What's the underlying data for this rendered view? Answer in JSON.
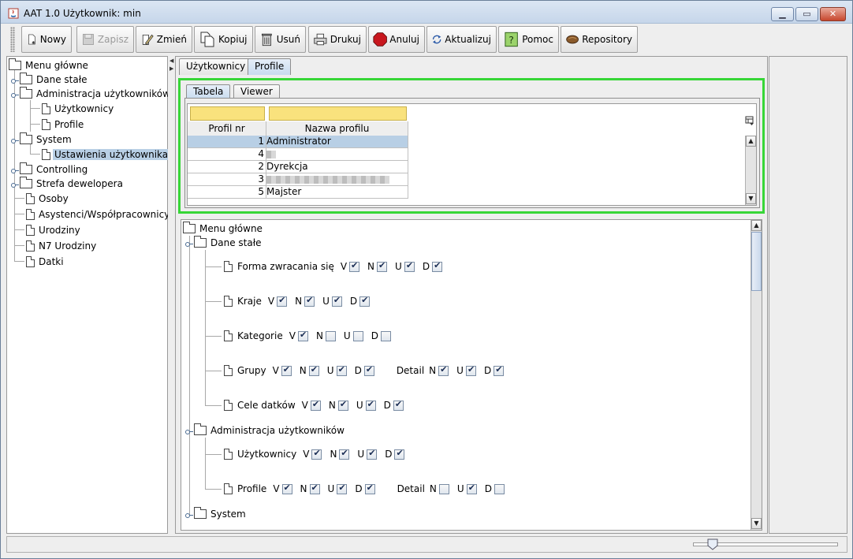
{
  "window": {
    "title": "AAT 1.0  Użytkownik: min",
    "controls": [
      "minimize",
      "maximize",
      "close"
    ]
  },
  "toolbar": {
    "buttons": [
      {
        "label": "Nowy",
        "icon": "new-document-icon",
        "enabled": true
      },
      {
        "label": "Zapisz",
        "icon": "save-disk-icon",
        "enabled": false
      },
      {
        "label": "Zmień",
        "icon": "edit-pencil-icon",
        "enabled": true
      },
      {
        "label": "Kopiuj",
        "icon": "copy-icon",
        "enabled": true
      },
      {
        "label": "Usuń",
        "icon": "trash-icon",
        "enabled": true
      },
      {
        "label": "Drukuj",
        "icon": "printer-icon",
        "enabled": true
      },
      {
        "label": "Anuluj",
        "icon": "stop-icon",
        "enabled": true
      },
      {
        "label": "Aktualizuj",
        "icon": "refresh-icon",
        "enabled": true
      },
      {
        "label": "Pomoc",
        "icon": "help-icon",
        "enabled": true
      },
      {
        "label": "Repository",
        "icon": "repository-icon",
        "enabled": true
      }
    ]
  },
  "sidebar": {
    "root": "Menu główne",
    "items": [
      {
        "label": "Dane stałe",
        "type": "folder"
      },
      {
        "label": "Administracja użytkowników",
        "type": "folder"
      },
      {
        "label": "Użytkownicy",
        "type": "doc"
      },
      {
        "label": "Profile",
        "type": "doc"
      },
      {
        "label": "System",
        "type": "folder"
      },
      {
        "label": "Ustawienia użytkownika",
        "type": "doc",
        "selected": true
      },
      {
        "label": "Controlling",
        "type": "folder"
      },
      {
        "label": "Strefa dewelopera",
        "type": "folder"
      },
      {
        "label": "Osoby",
        "type": "doc"
      },
      {
        "label": "Asystenci/Współpracownicy",
        "type": "doc"
      },
      {
        "label": "Urodziny",
        "type": "doc"
      },
      {
        "label": "N7 Urodziny",
        "type": "doc"
      },
      {
        "label": "Datki",
        "type": "doc"
      }
    ]
  },
  "tabs": {
    "outer": [
      {
        "label": "Użytkownicy"
      },
      {
        "label": "Profile",
        "active": true
      }
    ],
    "inner": [
      {
        "label": "Tabela",
        "active": true
      },
      {
        "label": "Viewer"
      }
    ]
  },
  "table": {
    "columns": [
      "Profil nr",
      "Nazwa profilu"
    ],
    "rows": [
      {
        "nr": "1",
        "name": "Administrator",
        "selected": true
      },
      {
        "nr": "4",
        "name": "",
        "redacted": true
      },
      {
        "nr": "2",
        "name": "Dyrekcja"
      },
      {
        "nr": "3",
        "name": "",
        "redacted": true
      },
      {
        "nr": "5",
        "name": "Majster"
      }
    ]
  },
  "permissions": {
    "root": "Menu główne",
    "letters": {
      "v": "V",
      "n": "N",
      "u": "U",
      "d": "D",
      "detail": "Detail"
    },
    "groups": [
      {
        "label": "Dane stałe",
        "items": [
          {
            "name": "Forma zwracania się",
            "v": true,
            "n": true,
            "u": true,
            "d": true
          },
          {
            "name": "Kraje",
            "v": true,
            "n": true,
            "u": true,
            "d": true
          },
          {
            "name": "Kategorie",
            "v": true,
            "n": false,
            "u": false,
            "d": false
          },
          {
            "name": "Grupy",
            "v": true,
            "n": true,
            "u": true,
            "d": true,
            "detail": {
              "n": true,
              "u": true,
              "d": true
            }
          },
          {
            "name": "Cele datków",
            "v": true,
            "n": true,
            "u": true,
            "d": true
          }
        ]
      },
      {
        "label": "Administracja użytkowników",
        "items": [
          {
            "name": "Użytkownicy",
            "v": true,
            "n": true,
            "u": true,
            "d": true
          },
          {
            "name": "Profile",
            "v": true,
            "n": true,
            "u": true,
            "d": true,
            "detail": {
              "n": false,
              "u": true,
              "d": false
            }
          }
        ]
      },
      {
        "label": "System",
        "items": []
      }
    ]
  }
}
